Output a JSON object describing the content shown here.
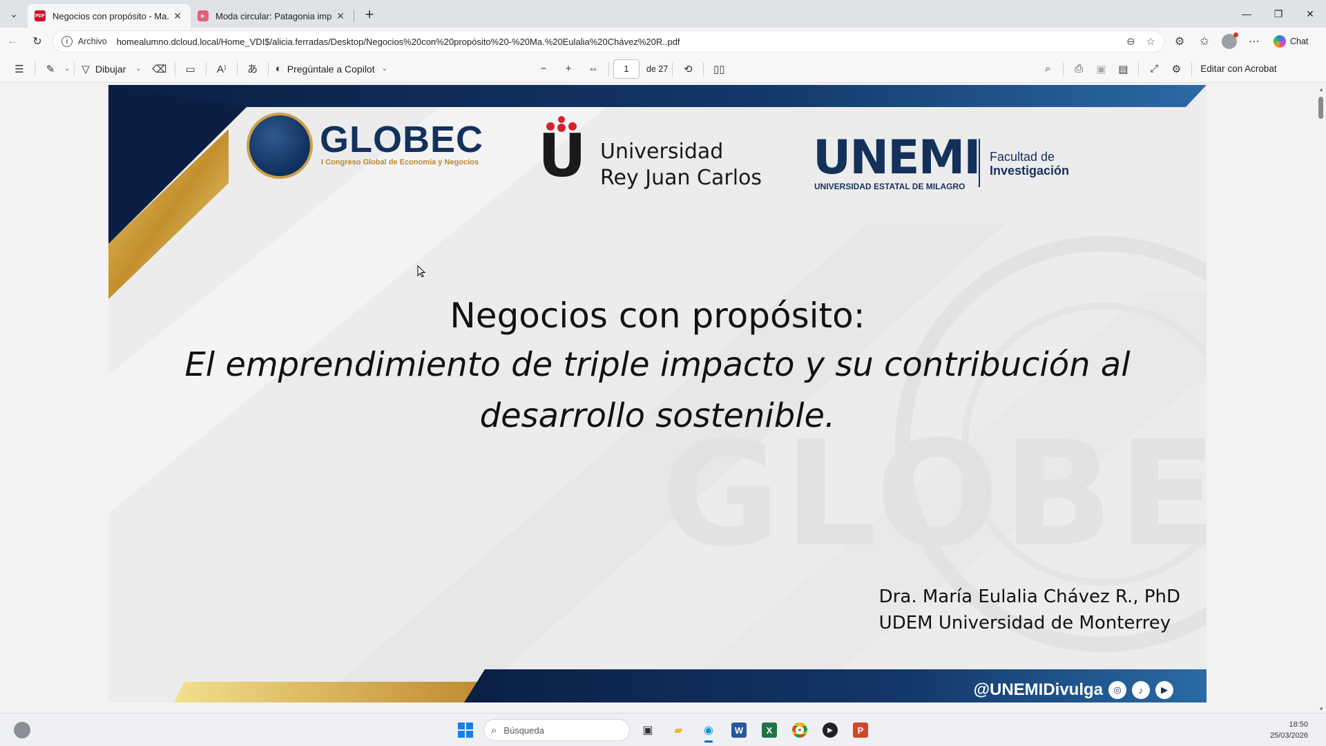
{
  "tabs": [
    {
      "label": "Negocios con propósito - Ma. Eulalia",
      "favicon": "pdf-icon",
      "active": true
    },
    {
      "label": "Moda circular: Patagonia implementa",
      "favicon": "youtube-icon",
      "active": false
    }
  ],
  "address": {
    "scheme": "Archivo",
    "url": "homealumno.dcloud.local/Home_VDI$/alicia.ferradas/Desktop/Negocios%20con%20propósito%20-%20Ma.%20Eulalia%20Chávez%20R..pdf"
  },
  "browser": {
    "chat_label": "Chat"
  },
  "pdf_toolbar": {
    "draw_label": "Dibujar",
    "copilot_label": "Pregúntale a Copilot",
    "page_current": "1",
    "page_total": "de 27",
    "acrobat_label": "Editar con Acrobat"
  },
  "slide": {
    "globec_name": "GLOBEC",
    "globec_sub": "I Congreso Global de Economía y Negocios",
    "urjc_line1": "Universidad",
    "urjc_line2": "Rey Juan Carlos",
    "unemi_name": "UNEMI",
    "unemi_sub": "UNIVERSIDAD ESTATAL DE MILAGRO",
    "unemi_fac1": "Facultad de",
    "unemi_fac2": "Investigación",
    "title_line1": "Negocios con propósito:",
    "title_line2": "El emprendimiento de triple impacto y su contribución al",
    "title_line3": "desarrollo sostenible.",
    "author_line1": "Dra. María Eulalia Chávez R., PhD",
    "author_line2": "UDEM Universidad de Monterrey",
    "handle": "@UNEMIDivulga",
    "watermark": "GLOBE"
  },
  "taskbar": {
    "search_placeholder": "Búsqueda",
    "time": "18:50",
    "date": "25/03/2026"
  },
  "colors": {
    "navy": "#12315e",
    "gold": "#c9a24a",
    "accent": "#0067c0"
  }
}
